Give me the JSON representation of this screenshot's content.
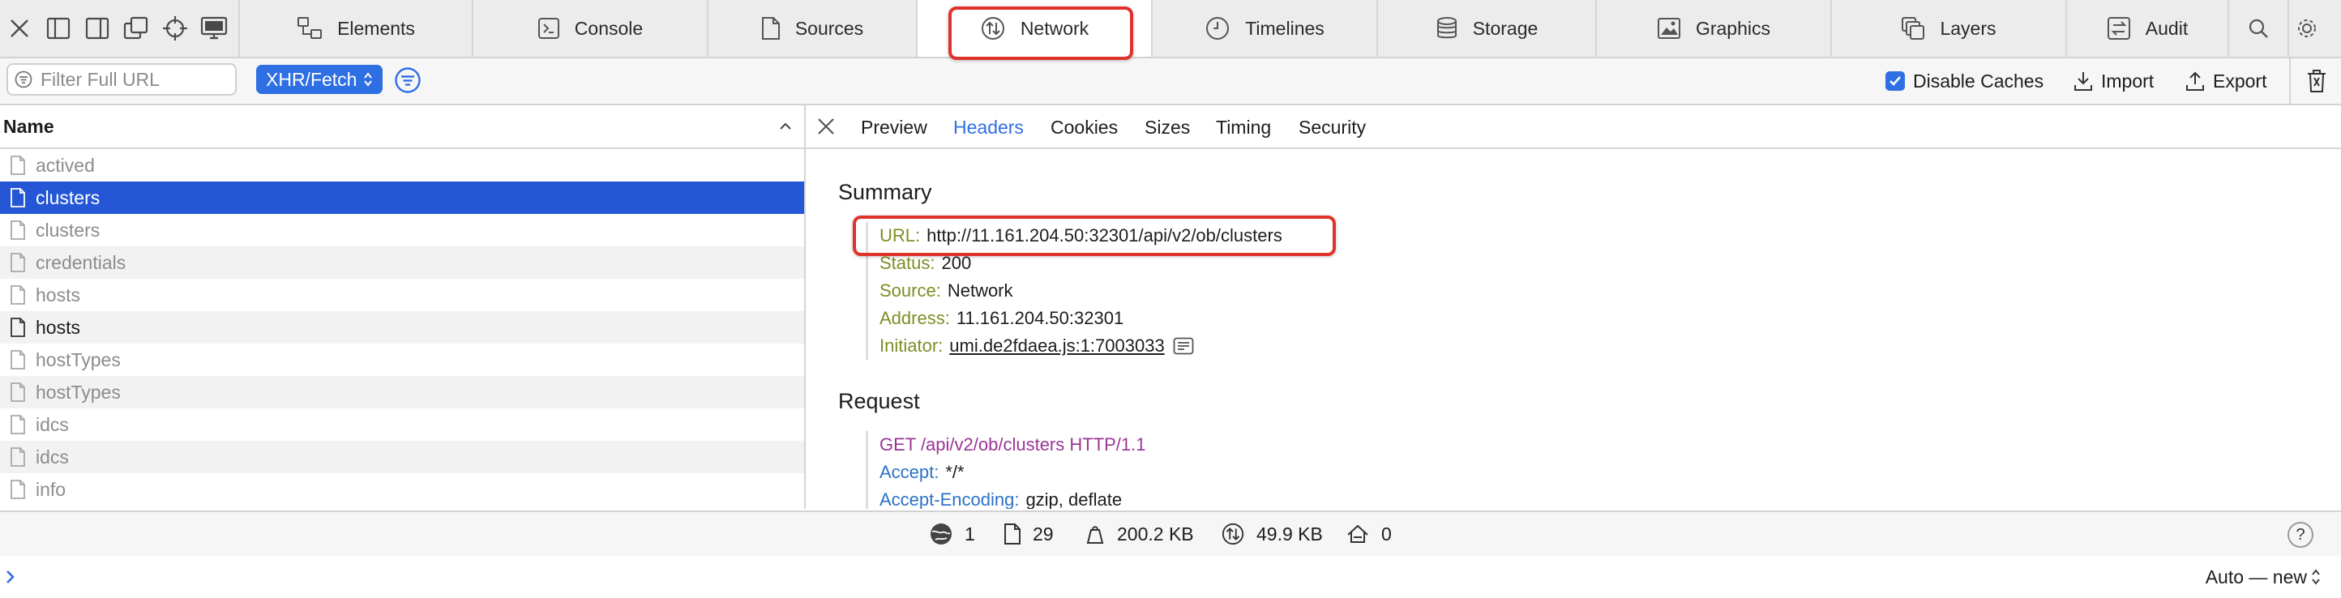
{
  "toolbar": {
    "icons": [
      "close-icon",
      "dock-side-icon",
      "dock-right-icon",
      "undock-icon",
      "inspect-icon",
      "device-icon"
    ],
    "search_icon": "search-icon",
    "settings_icon": "gear-icon"
  },
  "tabs": [
    {
      "label": "Elements",
      "icon": "elements-icon"
    },
    {
      "label": "Console",
      "icon": "console-icon"
    },
    {
      "label": "Sources",
      "icon": "sources-icon"
    },
    {
      "label": "Network",
      "icon": "network-icon",
      "active": true
    },
    {
      "label": "Timelines",
      "icon": "timelines-icon"
    },
    {
      "label": "Storage",
      "icon": "storage-icon"
    },
    {
      "label": "Graphics",
      "icon": "graphics-icon"
    },
    {
      "label": "Layers",
      "icon": "layers-icon"
    },
    {
      "label": "Audit",
      "icon": "audit-icon"
    }
  ],
  "filter": {
    "placeholder": "Filter Full URL",
    "value": "",
    "type_selected": "XHR/Fetch",
    "disable_caches_label": "Disable Caches",
    "disable_caches_checked": true,
    "import_label": "Import",
    "export_label": "Export"
  },
  "list": {
    "header": "Name",
    "rows": [
      {
        "name": "actived",
        "style": "dim"
      },
      {
        "name": "clusters",
        "style": "selected"
      },
      {
        "name": "clusters",
        "style": "dim"
      },
      {
        "name": "credentials",
        "style": "dim"
      },
      {
        "name": "hosts",
        "style": "dim"
      },
      {
        "name": "hosts",
        "style": "dark"
      },
      {
        "name": "hostTypes",
        "style": "dim"
      },
      {
        "name": "hostTypes",
        "style": "dim"
      },
      {
        "name": "idcs",
        "style": "dim"
      },
      {
        "name": "idcs",
        "style": "dim"
      },
      {
        "name": "info",
        "style": "dim"
      }
    ]
  },
  "details": {
    "tabs": [
      {
        "label": "Preview"
      },
      {
        "label": "Headers",
        "active": true
      },
      {
        "label": "Cookies"
      },
      {
        "label": "Sizes"
      },
      {
        "label": "Timing"
      },
      {
        "label": "Security"
      }
    ],
    "summary_title": "Summary",
    "summary": {
      "url_key": "URL:",
      "url": "http://11.161.204.50:32301/api/v2/ob/clusters",
      "status_key": "Status:",
      "status": "200",
      "source_key": "Source:",
      "source": "Network",
      "address_key": "Address:",
      "address": "11.161.204.50:32301",
      "initiator_key": "Initiator:",
      "initiator": "umi.de2fdaea.js:1:7003033"
    },
    "request_title": "Request",
    "request": {
      "line": "GET /api/v2/ob/clusters HTTP/1.1",
      "accept_key": "Accept:",
      "accept": "*/*",
      "encoding_key": "Accept-Encoding:",
      "encoding": "gzip, deflate"
    }
  },
  "status": {
    "domains": "1",
    "resources": "29",
    "transferred": "200.2 KB",
    "size": "49.9 KB",
    "errors": "0",
    "help": "?"
  },
  "console": {
    "prompt_icon": "chevron-right-icon",
    "context": "Auto — new"
  },
  "colors": {
    "accent": "#2f6fe4",
    "selected_row": "#2456d6",
    "highlight": "#e0312a",
    "summary_key": "#7d8f24",
    "request_key": "#2c72c7",
    "request_line": "#9a3596"
  }
}
